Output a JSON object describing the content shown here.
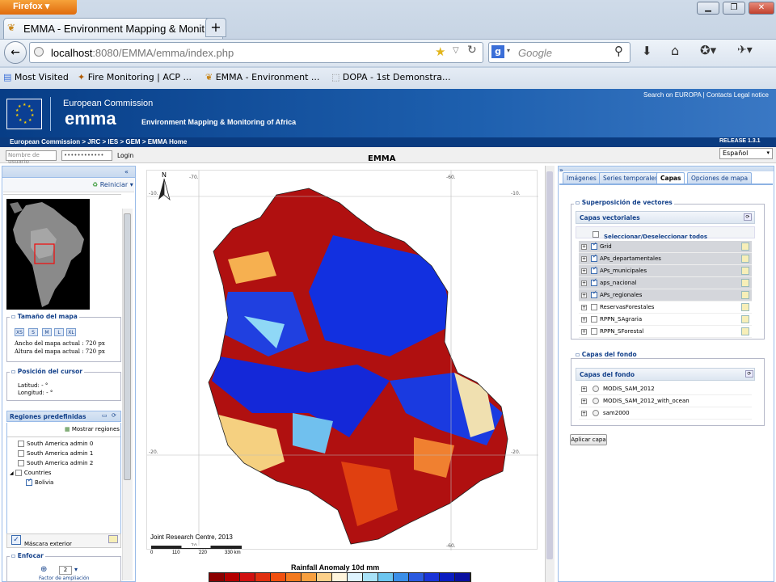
{
  "browser": {
    "menu_button": "Firefox",
    "tab_title": "EMMA - Environment Mapping & Monit...",
    "url_host": "localhost",
    "url_rest": ":8080/EMMA/emma/index.php",
    "search_placeholder": "Google",
    "bookmarks": [
      "Most Visited",
      "Fire Monitoring | ACP ...",
      "EMMA - Environment ...",
      "DOPA - 1st Demonstra..."
    ]
  },
  "site_header": {
    "org": "European Commission",
    "app": "emma",
    "subtitle": "Environment Mapping & Monitoring of Africa",
    "links": "Search on EUROPA | Contacts   Legal notice",
    "breadcrumb": "European Commission  >  JRC  >  IES  >  GEM  >  EMMA Home",
    "release": "RELEASE 1.3.1"
  },
  "appbar": {
    "username_placeholder": "Nombre de usuario",
    "password_placeholder": "••••••••••••",
    "login_label": "Login",
    "title": "EMMA",
    "language": "Español"
  },
  "left": {
    "reset_label": "Reiniciar",
    "map_size_legend": "Tamaño del mapa",
    "size_buttons": [
      "XS",
      "S",
      "M",
      "L",
      "XL"
    ],
    "map_width": "Ancho del mapa actual : 720 px",
    "map_height": "Altura del mapa actual : 720 px",
    "cursor_legend": "Posición del cursor",
    "lat_label": "Latitud:",
    "lat_value": "- °",
    "lon_label": "Longitud:",
    "lon_value": "- °",
    "regions_title": "Regiones predefinidas",
    "show_regions": "Mostrar regiones",
    "regions": [
      {
        "label": "South America admin 0",
        "checked": false
      },
      {
        "label": "South America admin 1",
        "checked": false
      },
      {
        "label": "South America admin 2",
        "checked": false
      },
      {
        "label": "Countries",
        "checked": false
      },
      {
        "label": "Bolivia",
        "checked": true
      }
    ],
    "mask_label": "Máscara exterior",
    "zoom_legend": "Enfocar",
    "zoom_value": "2",
    "zoom_factor_label": "Factor de ampliación"
  },
  "map": {
    "north": "N",
    "lon_ticks": [
      "-70.",
      "-60."
    ],
    "lat_ticks": [
      "-10.",
      "-20."
    ],
    "credit": "Joint Research Centre, 2013",
    "scale_labels": [
      "0",
      "110",
      "220",
      "330 km"
    ],
    "legend_title": "Rainfall Anomaly 10d mm",
    "legend_colors": [
      "#8b0000",
      "#b40000",
      "#d01010",
      "#e03010",
      "#f05010",
      "#f47a20",
      "#f8a040",
      "#fcd08a",
      "#fff5dc",
      "#dff4ff",
      "#a8e2f8",
      "#6cc6f0",
      "#3a8ee8",
      "#2a5ae0",
      "#1a34d8",
      "#0a1cc0",
      "#0a10a0"
    ]
  },
  "right": {
    "tabs": [
      "Imágenes",
      "Series temporales",
      "Capas",
      "Opciones de mapa"
    ],
    "active_tab": "Capas",
    "vector_legend": "Superposición de vectores",
    "vector_title": "Capas vectoriales",
    "select_all": "Seleccionar/Deseleccionar todos",
    "vector_layers": [
      {
        "label": "Grid",
        "checked": true
      },
      {
        "label": "APs_departamentales",
        "checked": true
      },
      {
        "label": "APs_municipales",
        "checked": true
      },
      {
        "label": "aps_nacional",
        "checked": true
      },
      {
        "label": "APs_regionales",
        "checked": true
      },
      {
        "label": "ReservasForestales",
        "checked": false
      },
      {
        "label": "RPPN_SAgraria",
        "checked": false
      },
      {
        "label": "RPPN_SForestal",
        "checked": false
      }
    ],
    "bg_legend": "Capas del fondo",
    "bg_title": "Capas del fondo",
    "bg_layers": [
      "MODIS_SAM_2012",
      "MODIS_SAM_2012_with_ocean",
      "sam2000"
    ],
    "apply_label": "Aplicar capa"
  }
}
